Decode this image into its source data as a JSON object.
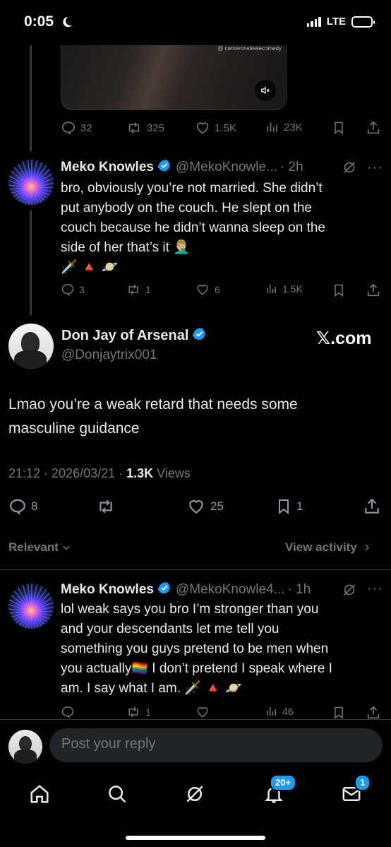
{
  "status_bar": {
    "time": "0:05",
    "network": "LTE",
    "battery_level": 0.45
  },
  "media": {
    "watermark": "@ cameronsteelecomedy"
  },
  "top_tweet_actions": {
    "replies": "32",
    "reposts": "325",
    "likes": "1.5K",
    "views": "23K"
  },
  "reply1": {
    "name": "Meko Knowles",
    "handle": "@MekoKnowle...",
    "time": "· 2h",
    "text_lines": [
      "bro, obviously you’re not married. She didn’t",
      "put anybody on the couch. He slept on the",
      "couch because he didn’t wanna sleep on the",
      "side of her that’s it 🤦🏼‍♂️"
    ],
    "emoji_line": "🗡️ 🔺 🪐",
    "replies": "3",
    "reposts": "1",
    "likes": "6",
    "views": "1.5K"
  },
  "main_tweet": {
    "name": "Don Jay of Arsenal",
    "handle": "@Donjaytrix001",
    "source_badge": "𝕏.com",
    "text_lines": [
      "Lmao you’re a weak retard that needs some",
      "masculine guidance"
    ],
    "timestamp": "21:12 · 2026/03/21 · ",
    "views_count": "1.3K",
    "views_label": " Views",
    "replies": "8",
    "likes": "25",
    "bookmarks": "1"
  },
  "sort_bar": {
    "relevant": "Relevant",
    "view_activity": "View activity"
  },
  "reply2": {
    "name": "Meko Knowles",
    "handle": "@MekoKnowle4...",
    "time": "· 1h",
    "text_lines": [
      "lol weak says you bro I’m stronger than you",
      "and your descendants let me tell you",
      "something you guys pretend to be men when",
      "you actually🏳️‍🌈 I don’t pretend I speak where I",
      "am. I say what I am. 🗡️ 🔺 🪐"
    ],
    "reposts": "1",
    "views": "46"
  },
  "reply_bar": {
    "placeholder": "Post your reply"
  },
  "tab_bar": {
    "notifications_badge": "20+",
    "messages_badge": "1"
  },
  "colors": {
    "accent": "#1d9bf0",
    "muted": "#71767b",
    "background": "#000000"
  }
}
